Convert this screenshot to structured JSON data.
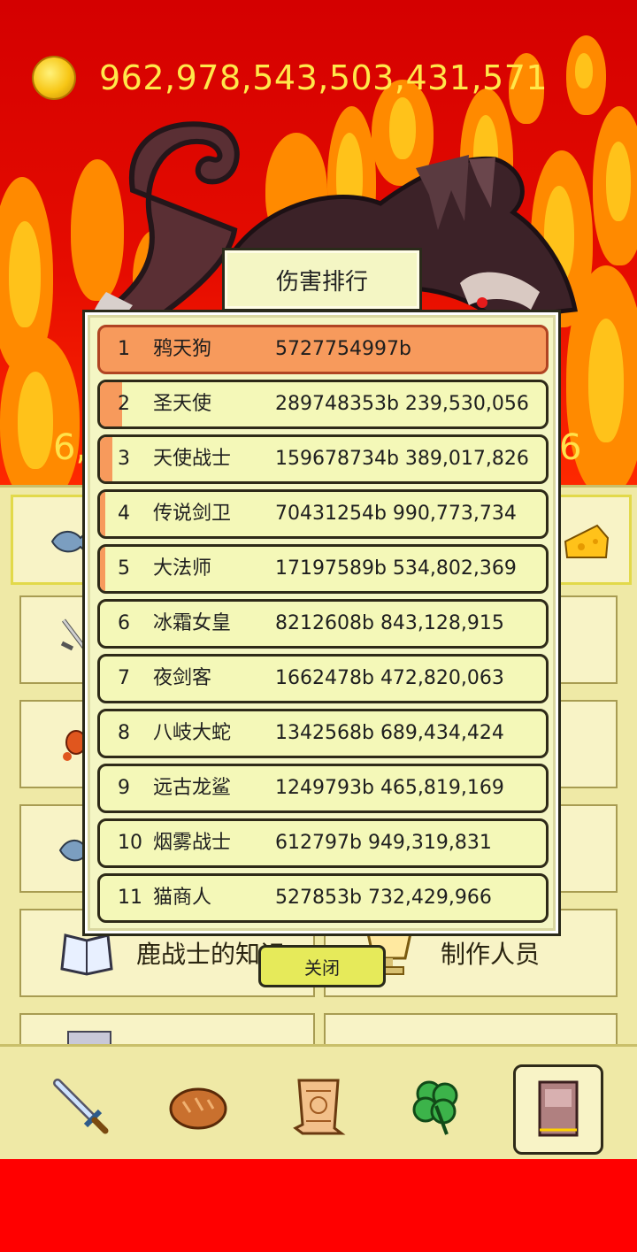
{
  "currency": {
    "amount": "962,978,543,503,431,571",
    "icon": "gold-coin-icon"
  },
  "side_numbers": {
    "left": "6,",
    "right": "6"
  },
  "modal": {
    "title": "伤害排行",
    "close_label": "关闭",
    "rows": [
      {
        "rank": "1",
        "name": "鸦天狗",
        "value": "5727754997b",
        "fill": 1.0
      },
      {
        "rank": "2",
        "name": "圣天使",
        "value": "289748353b 239,530,056",
        "fill": 0.05
      },
      {
        "rank": "3",
        "name": "天使战士",
        "value": "159678734b 389,017,826",
        "fill": 0.028
      },
      {
        "rank": "4",
        "name": "传说剑卫",
        "value": "70431254b 990,773,734",
        "fill": 0.012
      },
      {
        "rank": "5",
        "name": "大法师",
        "value": "17197589b 534,802,369",
        "fill": 0.003
      },
      {
        "rank": "6",
        "name": "冰霜女皇",
        "value": "8212608b 843,128,915",
        "fill": 0.0
      },
      {
        "rank": "7",
        "name": "夜剑客",
        "value": "1662478b 472,820,063",
        "fill": 0.0
      },
      {
        "rank": "8",
        "name": "八岐大蛇",
        "value": "1342568b 689,434,424",
        "fill": 0.0
      },
      {
        "rank": "9",
        "name": "远古龙鲨",
        "value": "1249793b 465,819,169",
        "fill": 0.0
      },
      {
        "rank": "10",
        "name": "烟雾战士",
        "value": "612797b 949,319,831",
        "fill": 0.0
      },
      {
        "rank": "11",
        "name": "猫商人",
        "value": "527853b 732,429,966",
        "fill": 0.0
      }
    ]
  },
  "menu": {
    "knowledge_label": "鹿战士的知识",
    "credits_label": "制作人员"
  },
  "bottom_nav": [
    {
      "icon": "sword-icon",
      "selected": false
    },
    {
      "icon": "bread-icon",
      "selected": false
    },
    {
      "icon": "scroll-icon",
      "selected": false
    },
    {
      "icon": "clover-icon",
      "selected": false
    },
    {
      "icon": "book-icon",
      "selected": true
    }
  ],
  "colors": {
    "background_red": "#e30000",
    "panel": "#efe9a6",
    "row_highlight": "#f79a5c",
    "coin_text": "#ffe84a"
  }
}
